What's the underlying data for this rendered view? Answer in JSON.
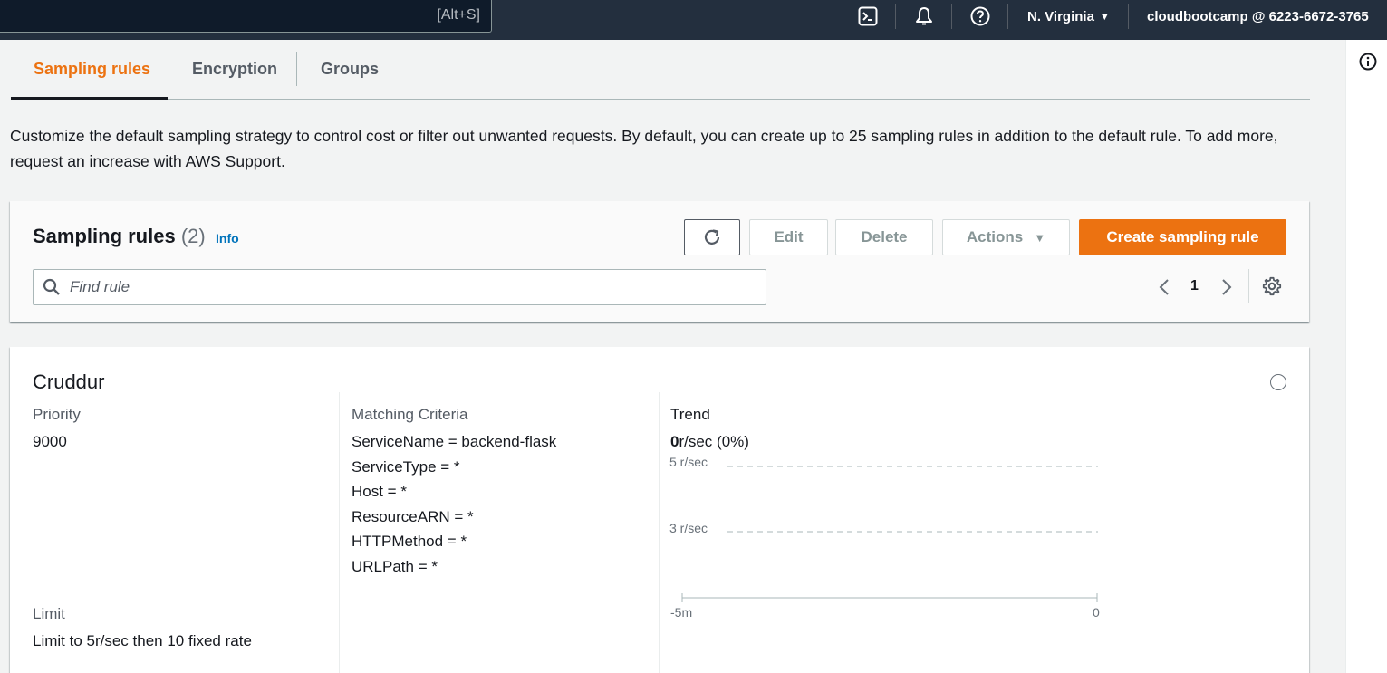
{
  "topnav": {
    "search_shortcut": "[Alt+S]",
    "icons": [
      "cloudshell-icon",
      "bell-icon",
      "help-icon"
    ],
    "region": "N. Virginia",
    "account": "cloudbootcamp @ 6223-6672-3765"
  },
  "tabs": [
    {
      "label": "Sampling rules",
      "active": true
    },
    {
      "label": "Encryption",
      "active": false
    },
    {
      "label": "Groups",
      "active": false
    }
  ],
  "description": "Customize the default sampling strategy to control cost or filter out unwanted requests. By default, you can create up to 25 sampling rules in addition to the default rule. To add more, request an increase with AWS Support.",
  "sampling_rules": {
    "title": "Sampling rules",
    "count": "(2)",
    "info_label": "Info",
    "buttons": {
      "edit": "Edit",
      "delete": "Delete",
      "actions": "Actions",
      "create": "Create sampling rule"
    },
    "search_placeholder": "Find rule",
    "page": "1"
  },
  "rule": {
    "name": "Cruddur",
    "priority_label": "Priority",
    "priority": "9000",
    "limit_label": "Limit",
    "limit": "Limit to 5r/sec then 10 fixed rate",
    "criteria_label": "Matching Criteria",
    "criteria": [
      "ServiceName = backend-flask",
      "ServiceType = *",
      "Host = *",
      "ResourceARN = *",
      "HTTPMethod = *",
      "URLPath = *"
    ],
    "trend_label": "Trend",
    "trend_value_bold": "0",
    "trend_value_rest": "r/sec (0%)",
    "trend_chart": {
      "y_ticks": [
        "5 r/sec",
        "3 r/sec"
      ],
      "x_ticks": [
        "-5m",
        "0"
      ]
    }
  },
  "colors": {
    "accent": "#ec7211",
    "nav_bg": "#232f3e",
    "link": "#0073bb"
  }
}
